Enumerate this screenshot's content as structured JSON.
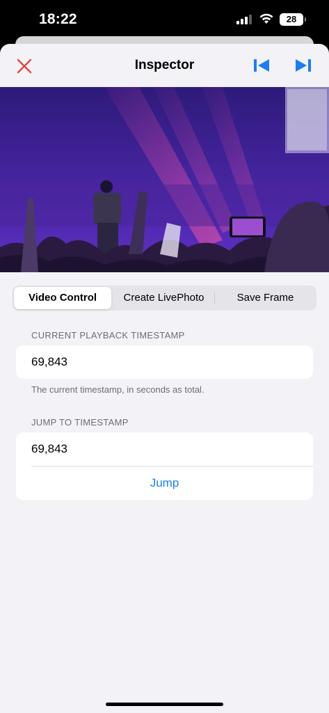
{
  "status": {
    "time": "18:22",
    "battery": "28"
  },
  "nav": {
    "title": "Inspector"
  },
  "tabs": [
    {
      "label": "Video Control",
      "active": true
    },
    {
      "label": "Create LivePhoto",
      "active": false
    },
    {
      "label": "Save Frame",
      "active": false
    }
  ],
  "current": {
    "header": "CURRENT PLAYBACK TIMESTAMP",
    "value": "69,843",
    "footer": "The current timestamp, in seconds as total."
  },
  "jump": {
    "header": "JUMP TO TIMESTAMP",
    "value": "69,843",
    "button_label": "Jump"
  },
  "colors": {
    "accent": "#1c7cf5",
    "close": "#e0463c",
    "background": "#f2f2f7"
  },
  "icons": [
    "close-icon",
    "skip-back-icon",
    "skip-forward-icon",
    "cellular-signal-icon",
    "wifi-icon",
    "battery-icon"
  ]
}
